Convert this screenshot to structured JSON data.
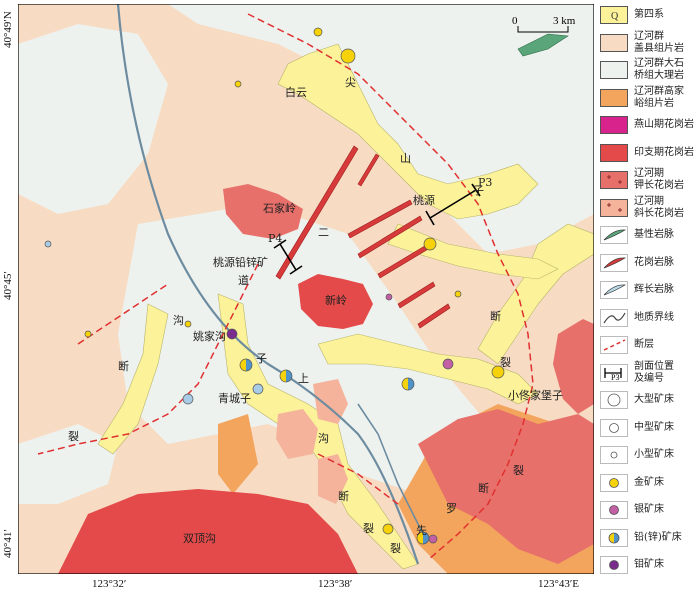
{
  "axis": {
    "lat_top": "40°49′N",
    "lat_mid": "40°45′",
    "lat_bottom": "40°41′",
    "lon_left": "123°32′",
    "lon_mid": "123°38′",
    "lon_right": "123°43′E"
  },
  "scale": {
    "zero": "0",
    "end": "3 km"
  },
  "places": {
    "baiyun": "白云",
    "jian": "尖",
    "shan": "山",
    "taoyuan": "桃源",
    "shijialing": "石家岭",
    "taoyuan_mine": "桃源铅锌矿",
    "xinling": "新岭",
    "dao": "道",
    "er": "二",
    "zi1": "子",
    "gou1": "沟",
    "yaojiagou": "姚家沟",
    "duan1": "断",
    "lie1": "裂",
    "zi2": "子",
    "shang": "上",
    "qingchengzi": "青城子",
    "gou2": "沟",
    "duan2": "断",
    "xiaotongjiabaozi": "小佟家堡子",
    "lie2": "裂",
    "lie3": "裂",
    "duan3": "断",
    "luo": "罗",
    "lie4": "裂",
    "xian": "先",
    "shuangdinggou": "双顶沟",
    "duan4": "断",
    "lie5": "裂"
  },
  "profiles": {
    "p3": "P3",
    "p4": "P4"
  },
  "legend": [
    {
      "lines": [
        "第四系"
      ],
      "color": "#fbf29a",
      "sym": "box",
      "box_text": "Q"
    },
    {
      "lines": [
        "辽河群",
        "盖县组片岩"
      ],
      "color": "#f7dcc3",
      "sym": "box"
    },
    {
      "lines": [
        "辽河群大石",
        "桥组大理岩"
      ],
      "color": "#eef2ef",
      "sym": "box"
    },
    {
      "lines": [
        "辽河群高家",
        "峪组片岩"
      ],
      "color": "#f4a55d",
      "sym": "box"
    },
    {
      "lines": [
        "燕山期花岗岩"
      ],
      "color": "#d9238c",
      "sym": "box"
    },
    {
      "lines": [
        "印支期花岗岩"
      ],
      "color": "#e44a4a",
      "sym": "box"
    },
    {
      "lines": [
        "辽河期",
        "钾长花岗岩"
      ],
      "color": "#e8706b",
      "sym": "cross"
    },
    {
      "lines": [
        "辽河期",
        "斜长花岗岩"
      ],
      "color": "#f5b39b",
      "sym": "cross"
    },
    {
      "lines": [
        "基性岩脉"
      ],
      "color": "#5aa57a",
      "sym": "dyke"
    },
    {
      "lines": [
        "花岗岩脉"
      ],
      "color": "#d63a3a",
      "sym": "dyke"
    },
    {
      "lines": [
        "辉长岩脉"
      ],
      "color": "#b9d8e6",
      "sym": "dyke"
    },
    {
      "lines": [
        "地质界线"
      ],
      "color": "#444444",
      "sym": "curve"
    },
    {
      "lines": [
        "断层"
      ],
      "color": "#e03030",
      "sym": "dash"
    },
    {
      "lines": [
        "剖面位置",
        "及编号"
      ],
      "color": "#000000",
      "sym": "profile",
      "box_text": "P3"
    },
    {
      "lines": [
        "大型矿床"
      ],
      "color": "#ffffff",
      "sym": "circle-l"
    },
    {
      "lines": [
        "中型矿床"
      ],
      "color": "#ffffff",
      "sym": "circle-m"
    },
    {
      "lines": [
        "小型矿床"
      ],
      "color": "#ffffff",
      "sym": "circle-s"
    },
    {
      "lines": [
        "金矿床"
      ],
      "color": "#f5d20a",
      "sym": "circle-m"
    },
    {
      "lines": [
        "银矿床"
      ],
      "color": "#c25fa5",
      "sym": "circle-m"
    },
    {
      "lines": [
        "铅(锌)矿床"
      ],
      "color": "#4f93c9",
      "sym": "half"
    },
    {
      "lines": [
        "钼矿床"
      ],
      "color": "#7a2d8c",
      "sym": "circle-m"
    }
  ]
}
